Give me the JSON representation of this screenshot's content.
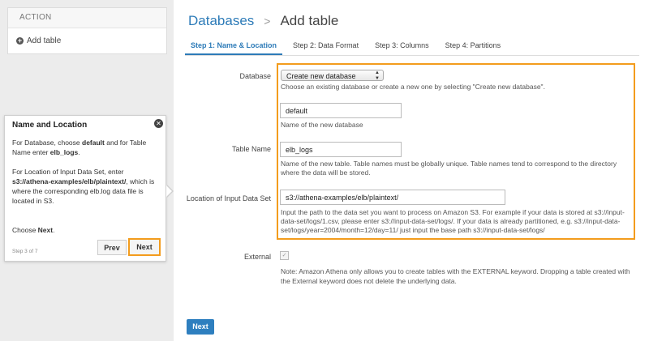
{
  "sidebar": {
    "header": "ACTION",
    "items": [
      {
        "label": "Add table",
        "icon": "plus-circle-icon"
      }
    ]
  },
  "breadcrumb": {
    "link": "Databases",
    "separator": ">",
    "current": "Add table"
  },
  "tabs": [
    {
      "label": "Step 1: Name & Location",
      "active": true
    },
    {
      "label": "Step 2: Data Format",
      "active": false
    },
    {
      "label": "Step 3: Columns",
      "active": false
    },
    {
      "label": "Step 4: Partitions",
      "active": false
    }
  ],
  "form": {
    "database": {
      "label": "Database",
      "selected": "Create new database",
      "help": "Choose an existing database or create a new one by selecting \"Create new database\".",
      "new_db_value": "default",
      "new_db_help": "Name of the new database"
    },
    "table_name": {
      "label": "Table Name",
      "value": "elb_logs",
      "help_line1": "Name of the new table. Table names must be globally unique. Table names tend to correspond to the directory",
      "help_line2": "where the data will be stored."
    },
    "location": {
      "label": "Location of Input Data Set",
      "value": "s3://athena-examples/elb/plaintext/",
      "help_line1": "Input the path to the data set you want to process on Amazon S3. For example if your data is stored at s3://input-",
      "help_line2": "data-set/logs/1.csv, please enter s3://input-data-set/logs/. If your data is already partitioned, e.g. s3://input-data-",
      "help_line3": "set/logs/year=2004/month=12/day=11/ just input the base path s3://input-data-set/logs/"
    },
    "external": {
      "label": "External",
      "checked": true,
      "help_line1": "Note: Amazon Athena only allows you to create tables with the EXTERNAL keyword. Dropping a table created with",
      "help_line2": "the External keyword does not delete the underlying data."
    },
    "next_label": "Next"
  },
  "tooltip": {
    "title": "Name and Location",
    "p1_a": "For Database, choose ",
    "p1_b": "default",
    "p1_c": " and for Table",
    "p1_d": "Name enter ",
    "p1_e": "elb_logs",
    "p1_f": ".",
    "p2_a": "For Location of Input Data Set, enter",
    "p2_b": "s3://athena-examples/elb/plaintext/",
    "p2_c": ", which is",
    "p2_d": "where the corresponding elb.log data file is",
    "p2_e": "located in S3.",
    "p3_a": "Choose ",
    "p3_b": "Next",
    "p3_c": ".",
    "step": "Step 3 of 7",
    "prev_label": "Prev",
    "next_label": "Next"
  },
  "colors": {
    "accent": "#2d7bb8",
    "highlight": "#f39c1d"
  }
}
